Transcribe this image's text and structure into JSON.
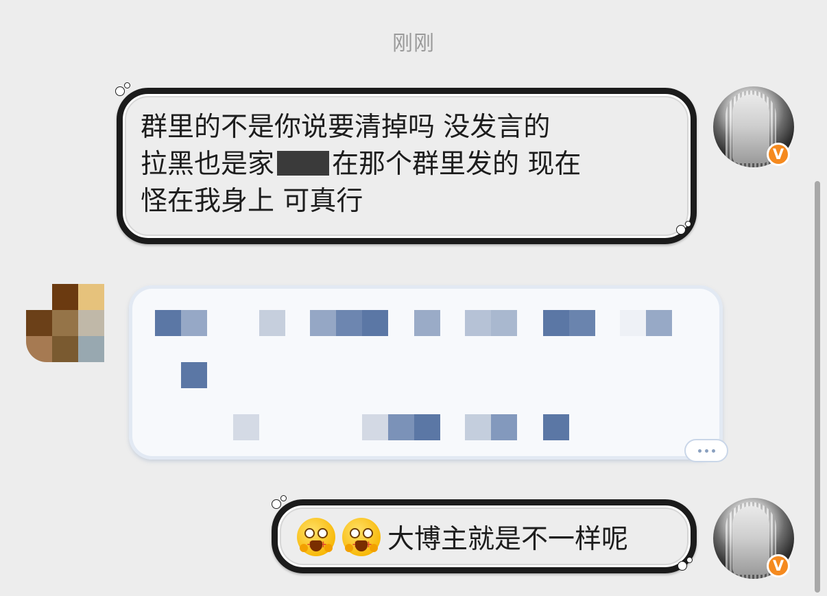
{
  "timestamp": "刚刚",
  "messages": [
    {
      "direction": "outgoing",
      "lines": [
        "群里的不是你说要清掉吗 没发言的",
        "拉黑也是家",
        "在那个群里发的 现在",
        "怪在我身上 可真行"
      ]
    },
    {
      "direction": "incoming",
      "text": "[pixelated]"
    },
    {
      "direction": "outgoing",
      "emoji": [
        "grinning-face-with-starry-eyes",
        "grinning-face-with-starry-eyes"
      ],
      "text": "大博主就是不一样呢"
    }
  ],
  "avatar": {
    "badge": "V",
    "badge_color": "#f58a1f"
  },
  "colors": {
    "background": "#ededed",
    "bubble_border": "#1b1b1b",
    "incoming_bubble": "#f7f9fc",
    "mosaic_blue": "#5b77a5"
  }
}
